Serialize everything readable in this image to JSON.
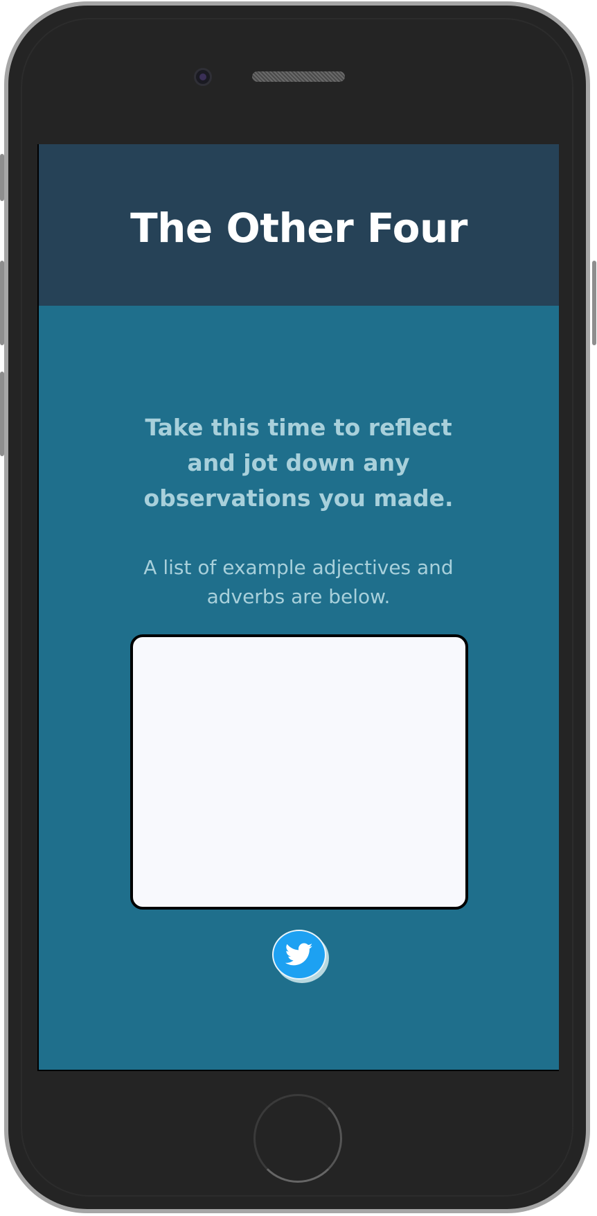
{
  "app": {
    "title": "The Other Four"
  },
  "reflection": {
    "heading": "Take this time to reflect and jot down any observations you made.",
    "subtext": "A list of example adjectives and adverbs are below.",
    "notes_value": ""
  },
  "share": {
    "icon": "twitter-icon"
  },
  "colors": {
    "header_bg": "#264257",
    "content_bg": "#1f6f8c",
    "text_accent": "#a8d0db",
    "twitter_blue": "#1da1f2"
  }
}
